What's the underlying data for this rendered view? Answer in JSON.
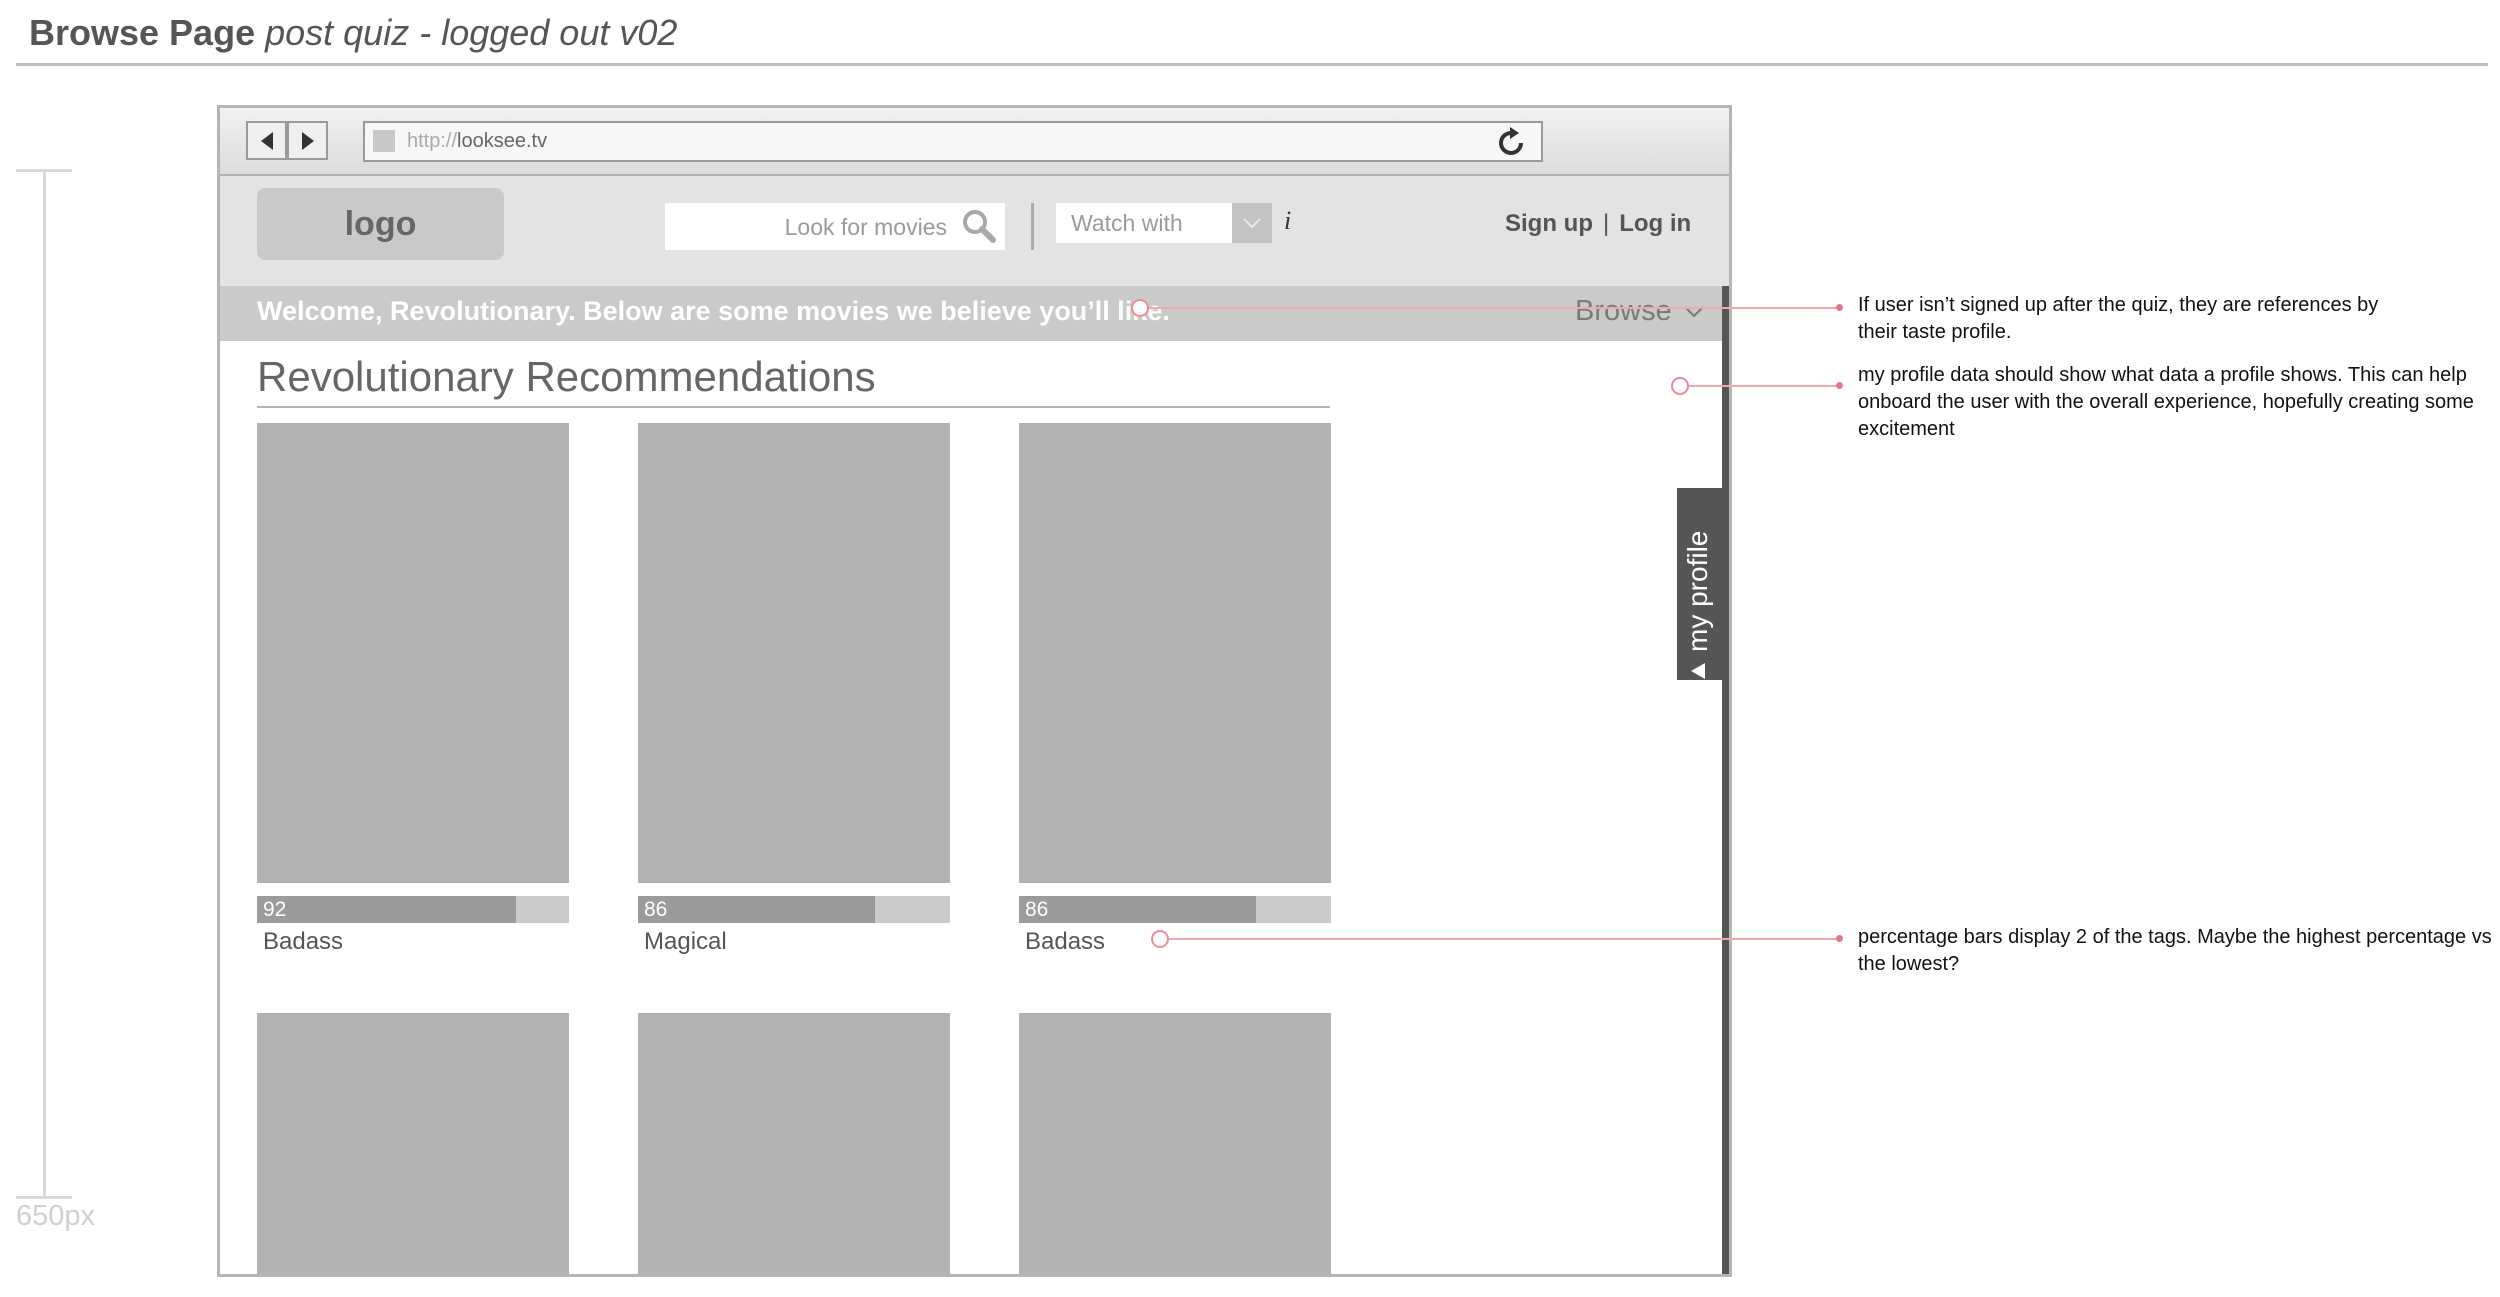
{
  "page": {
    "title_bold": "Browse Page",
    "title_italic": "post quiz - logged out v02",
    "ruler_label": "650px"
  },
  "browser": {
    "url_protocol": "http://",
    "url_domain": "looksee.tv",
    "back_icon": "triangle-left-icon",
    "forward_icon": "triangle-right-icon",
    "reload_icon": "reload-icon"
  },
  "header": {
    "logo": "logo",
    "search_placeholder": "Look for movies",
    "watch_with": "Watch with",
    "info": "i",
    "sign_up": "Sign up",
    "separator": "|",
    "log_in": "Log in"
  },
  "banner": {
    "text": "Welcome, Revolutionary. Below are some movies we believe you’ll like.",
    "browse": "Browse"
  },
  "sidebar": {
    "my_profile": "my profile"
  },
  "section": {
    "title": "Revolutionary Recommendations"
  },
  "movies": [
    {
      "score": "92",
      "percent": 83,
      "tag": "Badass"
    },
    {
      "score": "86",
      "percent": 76,
      "tag": "Magical"
    },
    {
      "score": "86",
      "percent": 76,
      "tag": "Badass"
    }
  ],
  "annotations": [
    "If user isn’t signed up after the quiz, they are references by their taste profile.",
    "my profile data should show what data a profile shows. This can help onboard the user with the overall experience, hopefully creating some excitement",
    "percentage bars display 2 of the tags. Maybe the highest percentage vs the lowest?"
  ],
  "colors": {
    "annotation_line": "#f4a7b0",
    "placeholder_gray": "#b2b2b2",
    "rail": "#555555"
  }
}
